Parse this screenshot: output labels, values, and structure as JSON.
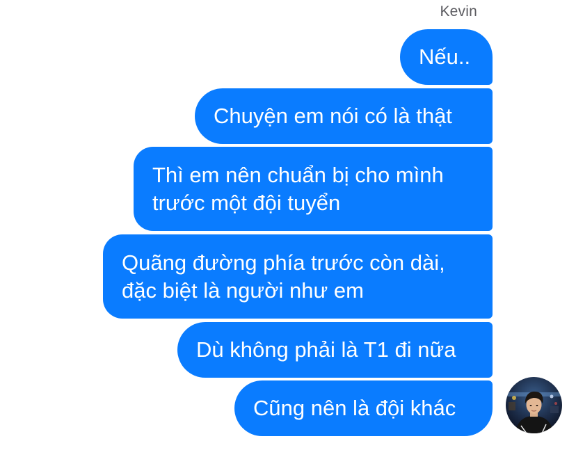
{
  "conversation": {
    "sender_name": "Kevin",
    "messages": [
      {
        "lines": [
          "Nếu.."
        ]
      },
      {
        "lines": [
          "Chuyện em nói có là thật"
        ]
      },
      {
        "lines": [
          "Thì em nên chuẩn bị cho mình",
          "trước một đội tuyển"
        ]
      },
      {
        "lines": [
          "Quãng đường phía trước còn dài,",
          "đặc biệt là người như em"
        ]
      },
      {
        "lines": [
          "Dù không phải là T1 đi nữa"
        ]
      },
      {
        "lines": [
          "Cũng nên là đội khác"
        ]
      }
    ]
  },
  "colors": {
    "bubble_background": "#0a7cff",
    "bubble_text": "#ffffff",
    "sender_text": "#5b5b60"
  },
  "avatar": {
    "icon": "profile-photo"
  }
}
